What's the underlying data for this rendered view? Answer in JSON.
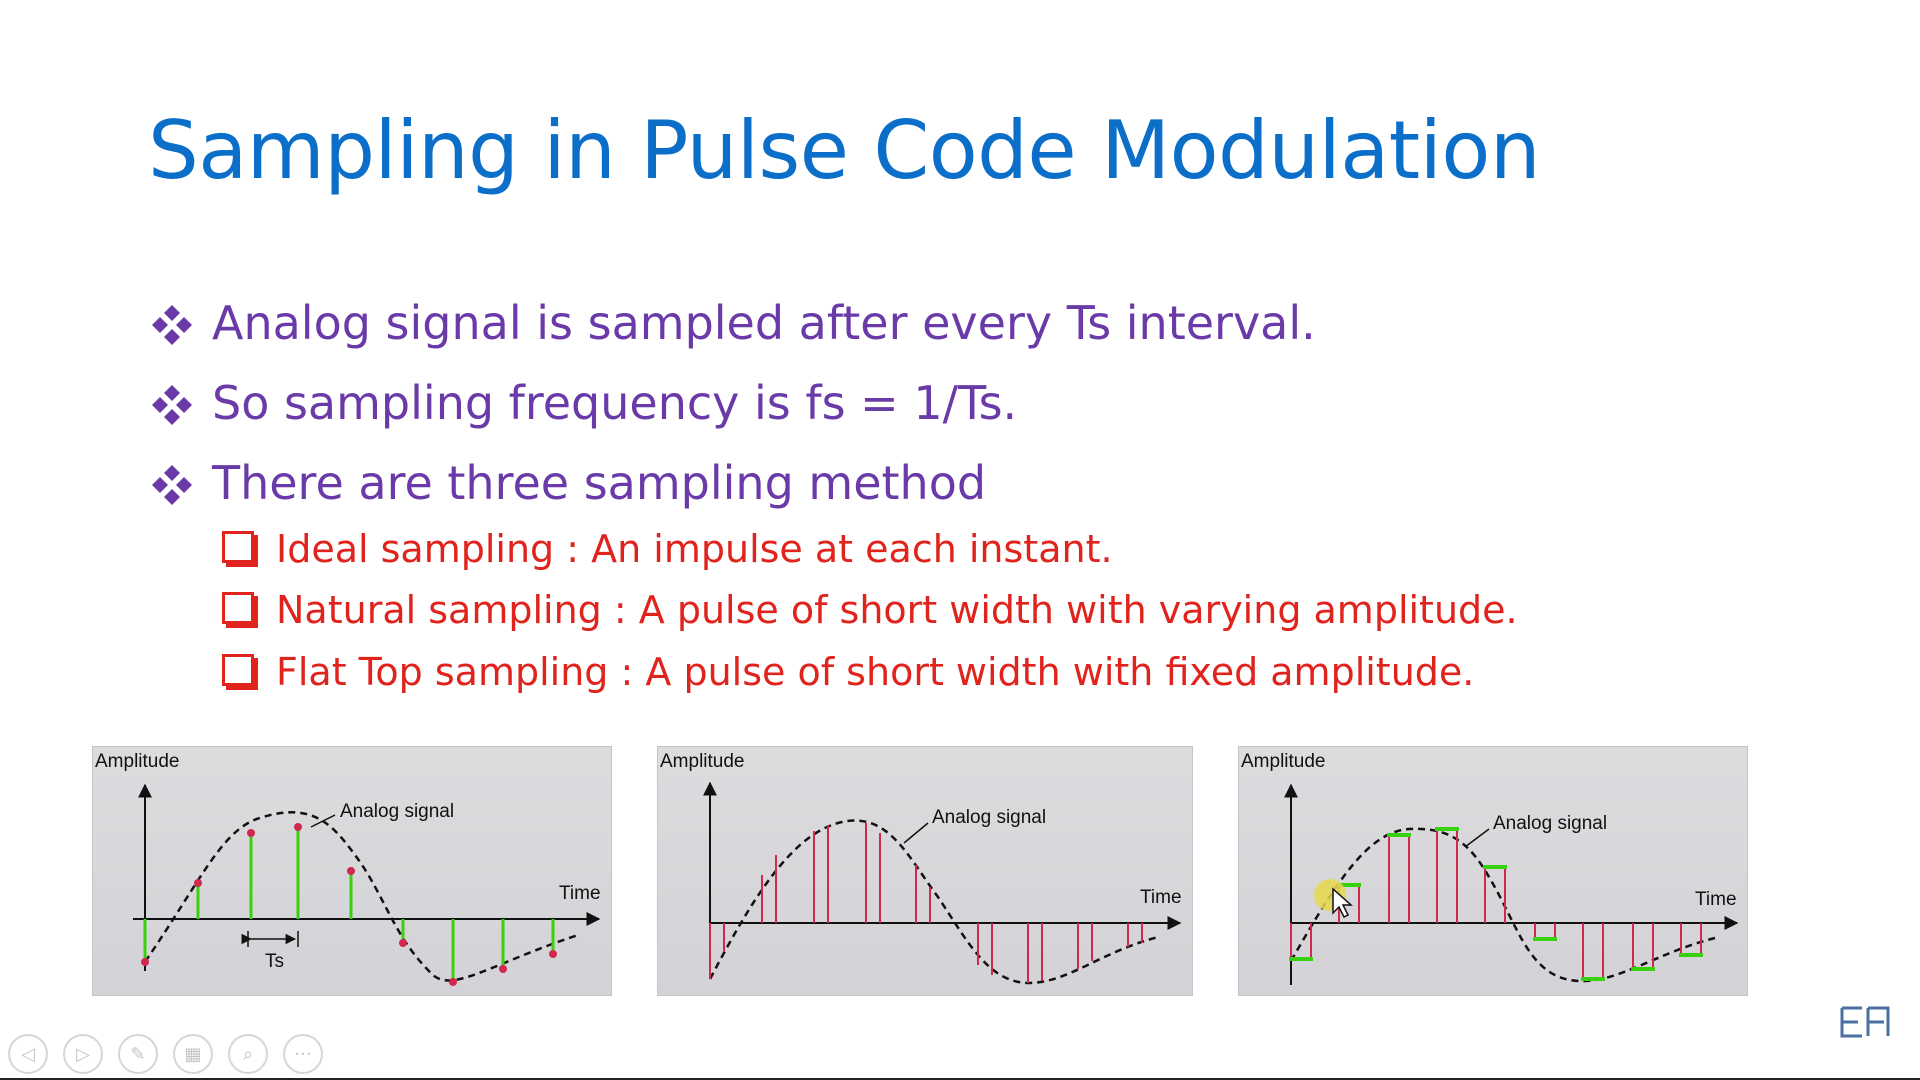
{
  "slide": {
    "title": "Sampling in Pulse Code Modulation",
    "bullets": [
      "Analog signal is sampled after every Ts interval.",
      "So sampling frequency is fs = 1/Ts.",
      "There are three sampling method"
    ],
    "sub_bullets": [
      "Ideal sampling : An impulse at each instant.",
      "Natural sampling : A pulse of short width with varying amplitude.",
      "Flat Top sampling : A pulse of short width with fixed amplitude."
    ],
    "colors": {
      "title": "#0b6fc9",
      "bullets": "#6a3aa8",
      "sub_bullets": "#e0231c",
      "sample_green": "#39d10f",
      "sample_red": "#d0284f"
    }
  },
  "figures": [
    {
      "ylabel": "Amplitude",
      "signal_label": "Analog signal",
      "xlabel": "Time",
      "interval_label": "Ts"
    },
    {
      "ylabel": "Amplitude",
      "signal_label": "Analog signal",
      "xlabel": "Time"
    },
    {
      "ylabel": "Amplitude",
      "signal_label": "Analog signal",
      "xlabel": "Time"
    }
  ],
  "toolbar": {
    "buttons": [
      {
        "icon": "previous-icon",
        "glyph": "◁"
      },
      {
        "icon": "next-icon",
        "glyph": "▷"
      },
      {
        "icon": "pen-icon",
        "glyph": "✎"
      },
      {
        "icon": "slides-icon",
        "glyph": "▦"
      },
      {
        "icon": "zoom-icon",
        "glyph": "⌕"
      },
      {
        "icon": "more-icon",
        "glyph": "···"
      }
    ]
  }
}
